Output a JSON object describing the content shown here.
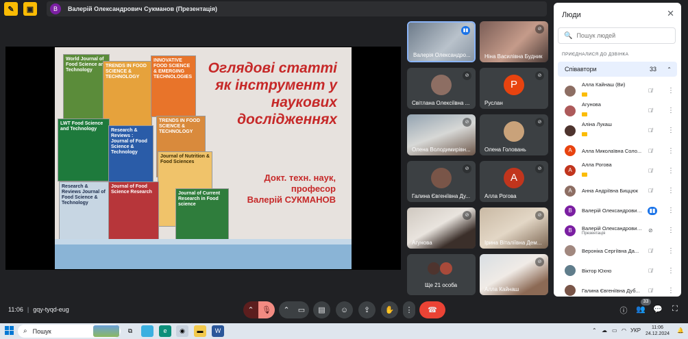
{
  "window": {
    "presenter_title": "Валерій Олександрович Сукманов (Презентація)",
    "presenter_initial": "В"
  },
  "slide": {
    "title_lines": [
      "Оглядові статті",
      "як інструмент у",
      "наукових",
      "дослідженнях"
    ],
    "author_lines": [
      "Докт. техн. наук,",
      "професор",
      "Валерій СУКМАНОВ"
    ],
    "covers": [
      "World Journal of Food Science and Technology",
      "TRENDS IN FOOD SCIENCE & TECHNOLOGY",
      "INNOVATIVE FOOD SCIENCE & EMERGING TECHNOLOGIES",
      "LWT Food Science and Technology",
      "Research & Reviews : Journal of Food Science & Technology",
      "TRENDS IN FOOD SCIENCE & TECHNOLOGY",
      "Journal of Nutrition & Food Sciences",
      "Research & Reviews Journal of Food Science & Technology",
      "Journal of Food Science Research",
      "Journal of Current Research in Food science"
    ]
  },
  "tiles": [
    {
      "name": "Валерія Олександро...",
      "type": "photo",
      "speaking": true
    },
    {
      "name": "Ніна Василівна Будник",
      "type": "photo"
    },
    {
      "name": "Світлана Олексіївна ...",
      "type": "photo-avatar"
    },
    {
      "name": "Руслан",
      "type": "letter",
      "letter": "Р",
      "color": "#e8430f"
    },
    {
      "name": "Олена Володимирівн...",
      "type": "photo"
    },
    {
      "name": "Олена Головань",
      "type": "photo-avatar"
    },
    {
      "name": "Галина Євгеніївна Ду...",
      "type": "photo-avatar"
    },
    {
      "name": "Алла Рогова",
      "type": "letter",
      "letter": "А",
      "color": "#d93b1f"
    },
    {
      "name": "Агунова",
      "type": "photo"
    },
    {
      "name": "Ірина Віталіївна Дем...",
      "type": "photo"
    },
    {
      "name": "Ще 21 особа",
      "type": "more"
    },
    {
      "name": "Алла Кайнаш",
      "type": "photo"
    }
  ],
  "bottom_bar": {
    "time": "11:06",
    "meeting_code": "gqy-tyqd-eug",
    "people_count": "33"
  },
  "people_panel": {
    "header": "Люди",
    "search_placeholder": "Пошук людей",
    "section_label": "ПРИЄДНАЛИСЯ ДО ДЗВІНКА",
    "group_name": "Співавтори",
    "group_count": "33",
    "participants": [
      {
        "name": "Алла Кайнаш (Ви)",
        "initial": "",
        "color": "#8d6e63",
        "badge": true,
        "mic": "muted"
      },
      {
        "name": "Агунова",
        "initial": "",
        "color": "#ad5a5a",
        "badge": true,
        "mic": "muted"
      },
      {
        "name": "Аліна Лукаш",
        "initial": "",
        "color": "#4e342e",
        "badge": true,
        "mic": "muted"
      },
      {
        "name": "Алла Миколаївна Соло...",
        "initial": "А",
        "color": "#e8430f",
        "badge": false,
        "mic": "muted"
      },
      {
        "name": "Алла Рогова",
        "initial": "А",
        "color": "#c1351d",
        "badge": true,
        "mic": "muted"
      },
      {
        "name": "Анна Андріївна Биццюк",
        "initial": "А",
        "color": "#8d6e63",
        "badge": false,
        "mic": "muted"
      },
      {
        "name": "Валерій Олександрович...",
        "initial": "В",
        "color": "#7b1fa2",
        "badge": false,
        "mic": "live"
      },
      {
        "name": "Валерій Олександрович...",
        "sub": "Презентація",
        "initial": "В",
        "color": "#7b1fa2",
        "badge": false,
        "mic": "off"
      },
      {
        "name": "Вероніка Сергіївна Да...",
        "initial": "",
        "color": "#a1887f",
        "badge": false,
        "mic": "muted"
      },
      {
        "name": "Віктор Юхно",
        "initial": "",
        "color": "#607d8b",
        "badge": false,
        "mic": "muted"
      },
      {
        "name": "Галина Євгеніївна Дуб...",
        "initial": "",
        "color": "#795548",
        "badge": false,
        "mic": "muted"
      }
    ]
  },
  "taskbar": {
    "search_label": "Пошук",
    "language": "УКР",
    "clock_time": "11:06",
    "clock_date": "24.12.2024"
  }
}
